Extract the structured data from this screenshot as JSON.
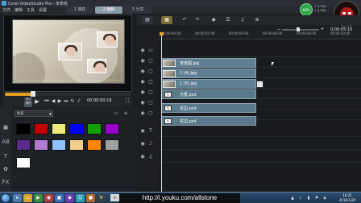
{
  "window": {
    "title": "Corel VideoStudio Pro - 未命名"
  },
  "menu": [
    "文件",
    "编辑",
    "工具",
    "设置"
  ],
  "steps": [
    {
      "label": "1 捕获",
      "active": false
    },
    {
      "label": "2 编辑",
      "active": true
    },
    {
      "label": "3 分享",
      "active": false
    }
  ],
  "counter": "60%",
  "net_speed": [
    "↑ 0.1K/s",
    "↓ 0.2K/s"
  ],
  "preview": {
    "timecode": "00:00:00:18",
    "project_label": "项目",
    "clip_label": "素材"
  },
  "library": {
    "dropdown": "色彩",
    "colors": [
      "#000000",
      "#c20000",
      "#eeeb7e",
      "#0000ff",
      "#10a000",
      "#9900cc",
      "#5b2b8e",
      "#b37ad5",
      "#8ec2ff",
      "#f2d08a",
      "#ff8800",
      "#a0a0a0",
      "#ffffff"
    ]
  },
  "timeline": {
    "timecode": "0:00:05:10",
    "ruler": [
      "00:00:00:00",
      "00:00:02:00",
      "00:00:04:00",
      "00:00:06:00",
      "00:00:08:00",
      "00:00:10:00"
    ],
    "clips": [
      {
        "label": "背景图.jpg",
        "type": "image"
      },
      {
        "label": "1 (4).jpg",
        "type": "image"
      },
      {
        "label": "1 (6).jpg",
        "type": "image"
      },
      {
        "label": "方框.psd",
        "type": "title"
      },
      {
        "label": "花边.psd",
        "type": "title"
      },
      {
        "label": "花边.psd",
        "type": "title"
      }
    ]
  },
  "taskbar": {
    "url": "http://i.youku.com/allstone",
    "lang": "中",
    "clock": [
      "16:21",
      "2016/1/29"
    ]
  }
}
